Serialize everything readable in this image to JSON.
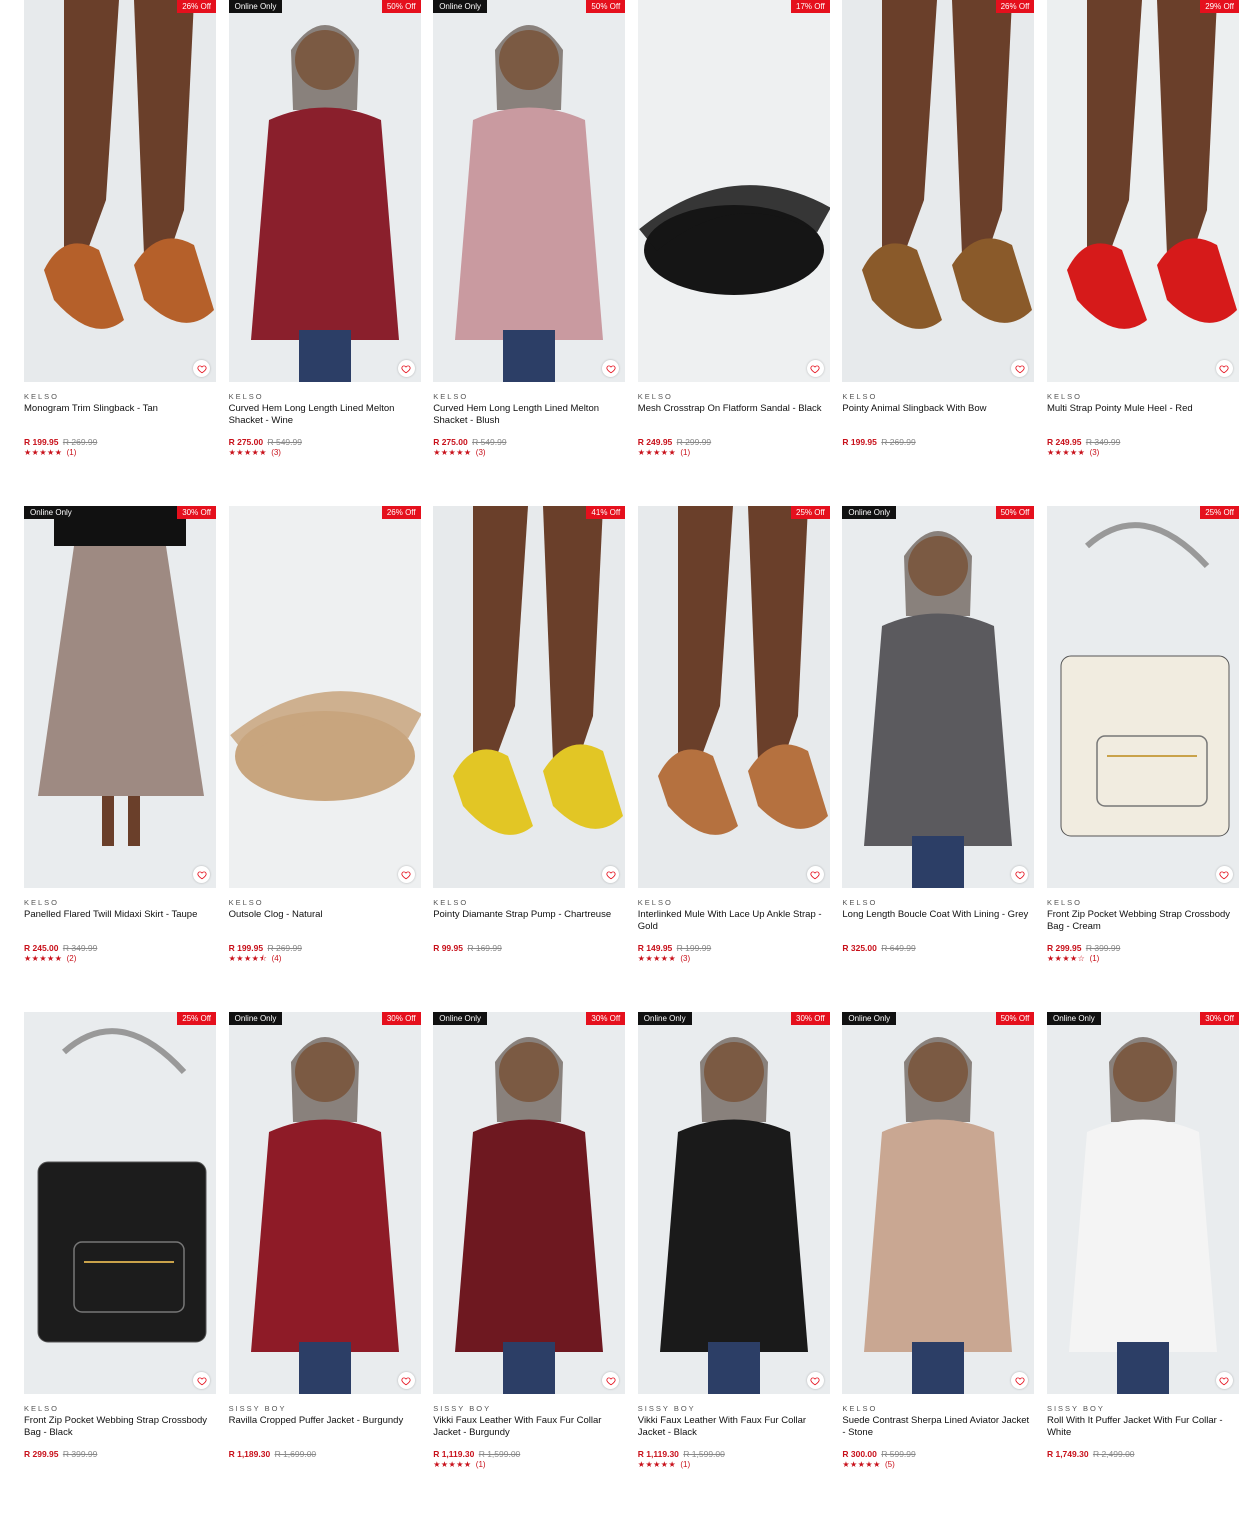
{
  "colors": {
    "discount_badge": "#e5101d",
    "online_badge": "#111111",
    "price": "#c8101a"
  },
  "products": [
    {
      "brand": "KELSO",
      "name": "Monogram Trim Slingback - Tan",
      "price": "R 199.95",
      "was": "R 269.99",
      "discount": "26% Off",
      "online": "",
      "stars": "★★★★★",
      "count": "(1)",
      "art": "shoe",
      "tone": "#b5602a",
      "bg": "#e7eaec"
    },
    {
      "brand": "KELSO",
      "name": "Curved Hem Long Length Lined Melton Shacket - Wine",
      "price": "R 275.00",
      "was": "R 549.99",
      "discount": "50% Off",
      "online": "Online Only",
      "stars": "★★★★★",
      "count": "(3)",
      "art": "person",
      "tone": "#8a1f2c",
      "bg": "#e9ecee"
    },
    {
      "brand": "KELSO",
      "name": "Curved Hem Long Length Lined Melton Shacket - Blush",
      "price": "R 275.00",
      "was": "R 549.99",
      "discount": "50% Off",
      "online": "Online Only",
      "stars": "★★★★★",
      "count": "(3)",
      "art": "person",
      "tone": "#c99aa0",
      "bg": "#e9ecee"
    },
    {
      "brand": "KELSO",
      "name": "Mesh Crosstrap On Flatform Sandal - Black",
      "price": "R 249.95",
      "was": "R 299.99",
      "discount": "17% Off",
      "online": "",
      "stars": "★★★★★",
      "count": "(1)",
      "art": "product",
      "tone": "#151515",
      "bg": "#eef0f1"
    },
    {
      "brand": "KELSO",
      "name": "Pointy Animal Slingback With Bow",
      "price": "R 199.95",
      "was": "R 269.99",
      "discount": "26% Off",
      "online": "",
      "stars": "",
      "count": "",
      "art": "shoe",
      "tone": "#8a5a2a",
      "bg": "#e7eaec"
    },
    {
      "brand": "KELSO",
      "name": "Multi Strap Pointy Mule Heel - Red",
      "price": "R 249.95",
      "was": "R 349.99",
      "discount": "29% Off",
      "online": "",
      "stars": "★★★★★",
      "count": "(3)",
      "art": "shoe",
      "tone": "#d61a1a",
      "bg": "#eceff0"
    },
    {
      "brand": "KELSO",
      "name": "Panelled Flared Twill Midaxi Skirt - Taupe",
      "price": "R 245.00",
      "was": "R 349.99",
      "discount": "30% Off",
      "online": "Online Only",
      "stars": "★★★★★",
      "count": "(2)",
      "art": "skirt",
      "tone": "#9e8a82",
      "bg": "#e9ecee"
    },
    {
      "brand": "KELSO",
      "name": "Outsole Clog - Natural",
      "price": "R 199.95",
      "was": "R 269.99",
      "discount": "26% Off",
      "online": "",
      "stars": "★★★★⯪",
      "count": "(4)",
      "art": "product",
      "tone": "#c8a57e",
      "bg": "#eef0f1"
    },
    {
      "brand": "KELSO",
      "name": "Pointy Diamante Strap Pump - Chartreuse",
      "price": "R 99.95",
      "was": "R 169.99",
      "discount": "41% Off",
      "online": "",
      "stars": "",
      "count": "",
      "art": "shoe",
      "tone": "#e2c625",
      "bg": "#e7eaec"
    },
    {
      "brand": "KELSO",
      "name": "Interlinked Mule With Lace Up Ankle Strap - Gold",
      "price": "R 149.95",
      "was": "R 199.99",
      "discount": "25% Off",
      "online": "",
      "stars": "★★★★★",
      "count": "(3)",
      "art": "shoe",
      "tone": "#b5713f",
      "bg": "#e7eaec"
    },
    {
      "brand": "KELSO",
      "name": "Long Length Boucle Coat With Lining - Grey",
      "price": "R 325.00",
      "was": "R 649.99",
      "discount": "50% Off",
      "online": "Online Only",
      "stars": "",
      "count": "",
      "art": "person",
      "tone": "#5b5a5e",
      "bg": "#e9ecee"
    },
    {
      "brand": "KELSO",
      "name": "Front Zip Pocket Webbing Strap Crossbody Bag - Cream",
      "price": "R 299.95",
      "was": "R 399.99",
      "discount": "25% Off",
      "online": "",
      "stars": "★★★★☆",
      "count": "(1)",
      "art": "bag",
      "tone": "#f1ece0",
      "bg": "#e9ecee"
    },
    {
      "brand": "KELSO",
      "name": "Front Zip Pocket Webbing Strap Crossbody Bag - Black",
      "price": "R 299.95",
      "was": "R 399.99",
      "discount": "25% Off",
      "online": "",
      "stars": "",
      "count": "",
      "art": "bag",
      "tone": "#1c1c1c",
      "bg": "#e9ecee"
    },
    {
      "brand": "SISSY BOY",
      "name": "Ravilla Cropped Puffer Jacket - Burgundy",
      "price": "R 1,189.30",
      "was": "R 1,699.00",
      "discount": "30% Off",
      "online": "Online Only",
      "stars": "",
      "count": "",
      "art": "person",
      "tone": "#8e1b27",
      "bg": "#e9ecee"
    },
    {
      "brand": "SISSY BOY",
      "name": "Vikki Faux Leather With Faux Fur Collar Jacket - Burgundy",
      "price": "R 1,119.30",
      "was": "R 1,599.00",
      "discount": "30% Off",
      "online": "Online Only",
      "stars": "★★★★★",
      "count": "(1)",
      "art": "person",
      "tone": "#6e1820",
      "bg": "#e9ecee"
    },
    {
      "brand": "SISSY BOY",
      "name": "Vikki Faux Leather With Faux Fur Collar Jacket - Black",
      "price": "R 1,119.30",
      "was": "R 1,599.00",
      "discount": "30% Off",
      "online": "Online Only",
      "stars": "★★★★★",
      "count": "(1)",
      "art": "person",
      "tone": "#1a1a1a",
      "bg": "#e9ecee"
    },
    {
      "brand": "KELSO",
      "name": "Suede Contrast Sherpa Lined Aviator Jacket - Stone",
      "price": "R 300.00",
      "was": "R 599.99",
      "discount": "50% Off",
      "online": "Online Only",
      "stars": "★★★★★",
      "count": "(5)",
      "art": "person",
      "tone": "#c9a792",
      "bg": "#e9ecee"
    },
    {
      "brand": "SISSY BOY",
      "name": "Roll With It Puffer Jacket With Fur Collar - White",
      "price": "R 1,749.30",
      "was": "R 2,499.00",
      "discount": "30% Off",
      "online": "Online Only",
      "stars": "",
      "count": "",
      "art": "person",
      "tone": "#f4f4f4",
      "bg": "#e9ecee"
    }
  ]
}
